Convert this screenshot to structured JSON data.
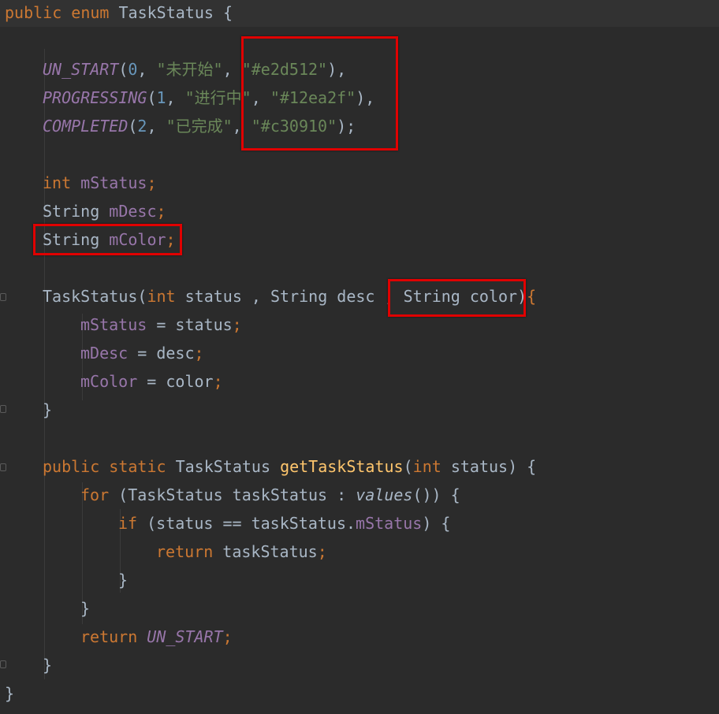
{
  "code": {
    "l1": {
      "a": "public",
      "b": "enum",
      "c": "TaskStatus",
      "d": "{"
    },
    "l3": {
      "name": "UN_START",
      "p1": "(",
      "n": "0",
      "s1": ", ",
      "str1": "\"未开始\"",
      "s2": ", ",
      "str2": "\"#e2d512\"",
      "end": "),"
    },
    "l4": {
      "name": "PROGRESSING",
      "p1": "(",
      "n": "1",
      "s1": ", ",
      "str1": "\"进行中\"",
      "s2": ", ",
      "str2": "\"#12ea2f\"",
      "end": "),"
    },
    "l5": {
      "name": "COMPLETED",
      "p1": "(",
      "n": "2",
      "s1": ", ",
      "str1": "\"已完成\"",
      "s2": ", ",
      "str2": "\"#c30910\"",
      "end": ");"
    },
    "l7": {
      "type": "int",
      "name": "mStatus",
      "semi": ";"
    },
    "l8": {
      "type": "String",
      "name": "mDesc",
      "semi": ";"
    },
    "l9": {
      "type": "String",
      "name": "mColor",
      "semi": ";"
    },
    "l11": {
      "ctor": "TaskStatus",
      "open": "(",
      "t1": "int",
      "p1": " status , ",
      "t2": "String",
      "p2": " desc , ",
      "t3": "String",
      "p3": " color",
      "close": ")",
      "brace": "{"
    },
    "l12": {
      "f": "mStatus",
      "eq": " = status",
      "semi": ";"
    },
    "l13": {
      "f": "mDesc",
      "eq": " = desc",
      "semi": ";"
    },
    "l14": {
      "f": "mColor",
      "eq": " = color",
      "semi": ";"
    },
    "l15": {
      "brace": "}"
    },
    "l17": {
      "k1": "public",
      "k2": "static",
      "type": "TaskStatus",
      "fn": "getTaskStatus",
      "open": "(",
      "t": "int",
      "p": " status) {"
    },
    "l18": {
      "k": "for",
      "a": " (TaskStatus taskStatus : ",
      "v": "values",
      "b": "()) {"
    },
    "l19": {
      "k": "if",
      "a": " (status == taskStatus.",
      "f": "mStatus",
      "b": ") {"
    },
    "l20": {
      "k": "return",
      "a": " taskStatus",
      "semi": ";"
    },
    "l21": {
      "brace": "}"
    },
    "l22": {
      "brace": "}"
    },
    "l23": {
      "k": "return",
      "v": "UN_START",
      "semi": ";"
    },
    "l24": {
      "brace": "}"
    },
    "l25": {
      "brace": "}"
    }
  },
  "colors": {
    "background": "#2b2b2b",
    "keyword": "#cc7832",
    "string": "#6a8759",
    "number": "#6897bb",
    "field": "#9876aa",
    "method": "#ffc66d",
    "highlight_box": "#e00000"
  }
}
